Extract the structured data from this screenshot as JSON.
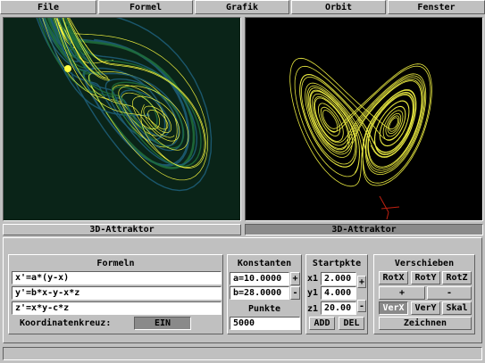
{
  "menu": [
    "File",
    "Formel",
    "Grafik",
    "Orbit",
    "Fenster"
  ],
  "views": {
    "left_title": "3D-Attraktor",
    "right_title": "3D-Attraktor"
  },
  "colors": {
    "left_bg": "#0a2418",
    "trail_yellow": "#ffff40",
    "trail_green": "#1f6d3a",
    "trail_blue": "#1d5d77",
    "right_bg": "#000000",
    "orbit_yellow": "#e8e840",
    "axis_red": "#c02010",
    "panel": "#c0c0c0",
    "active_button": "#8a8a8a"
  },
  "formeln": {
    "title": "Formeln",
    "lines": [
      "x'=a*(y-x)",
      "y'=b*x-y-x*z",
      "z'=x*y-c*z"
    ],
    "koordinatenkreuz_label": "Koordinatenkreuz:",
    "koordinatenkreuz_value": "EIN"
  },
  "konstanten": {
    "title": "Konstanten",
    "a": "a=10.0000",
    "b": "b=28.0000",
    "plus": "+",
    "minus": "-",
    "punkte_label": "Punkte",
    "punkte_value": "5000"
  },
  "startpkte": {
    "title": "Startpkte",
    "rows": [
      {
        "label": "x1",
        "value": "2.000"
      },
      {
        "label": "y1",
        "value": "4.000"
      },
      {
        "label": "z1",
        "value": "20.00"
      }
    ],
    "plus": "+",
    "minus": "-",
    "add": "ADD",
    "del": "DEL"
  },
  "verschieben": {
    "title": "Verschieben",
    "row1": [
      "RotX",
      "RotY",
      "RotZ"
    ],
    "plus": "+",
    "minus": "-",
    "row3": [
      "VerX",
      "VerY",
      "Skal"
    ],
    "active": "VerX",
    "draw": "Zeichnen"
  }
}
